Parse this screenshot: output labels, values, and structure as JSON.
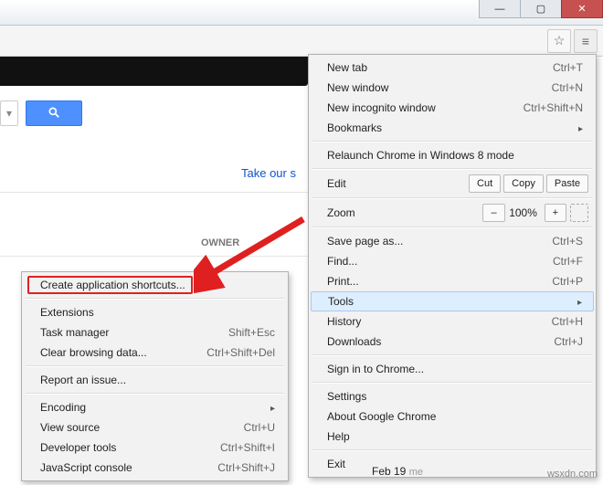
{
  "window": {
    "min": "—",
    "max": "▢",
    "close": "✕"
  },
  "toolbar": {
    "star_icon": "☆",
    "menu_icon": "≡"
  },
  "page": {
    "take_our": "Take our s",
    "owner": "OWNER",
    "feb": "Feb 19",
    "me": "me",
    "watermark": "wsxdn.com"
  },
  "menu": {
    "new_tab": "New tab",
    "new_tab_sc": "Ctrl+T",
    "new_window": "New window",
    "new_window_sc": "Ctrl+N",
    "incognito": "New incognito window",
    "incognito_sc": "Ctrl+Shift+N",
    "bookmarks": "Bookmarks",
    "relaunch": "Relaunch Chrome in Windows 8 mode",
    "edit": "Edit",
    "cut": "Cut",
    "copy": "Copy",
    "paste": "Paste",
    "zoom": "Zoom",
    "zoom_minus": "–",
    "zoom_val": "100%",
    "zoom_plus": "+",
    "save_as": "Save page as...",
    "save_as_sc": "Ctrl+S",
    "find": "Find...",
    "find_sc": "Ctrl+F",
    "print": "Print...",
    "print_sc": "Ctrl+P",
    "tools": "Tools",
    "history": "History",
    "history_sc": "Ctrl+H",
    "downloads": "Downloads",
    "downloads_sc": "Ctrl+J",
    "signin": "Sign in to Chrome...",
    "settings": "Settings",
    "about": "About Google Chrome",
    "help": "Help",
    "exit": "Exit"
  },
  "submenu": {
    "create_shortcuts": "Create application shortcuts...",
    "extensions": "Extensions",
    "taskmgr": "Task manager",
    "taskmgr_sc": "Shift+Esc",
    "clear": "Clear browsing data...",
    "clear_sc": "Ctrl+Shift+Del",
    "report": "Report an issue...",
    "encoding": "Encoding",
    "view_source": "View source",
    "view_source_sc": "Ctrl+U",
    "devtools": "Developer tools",
    "devtools_sc": "Ctrl+Shift+I",
    "jsconsole": "JavaScript console",
    "jsconsole_sc": "Ctrl+Shift+J"
  }
}
